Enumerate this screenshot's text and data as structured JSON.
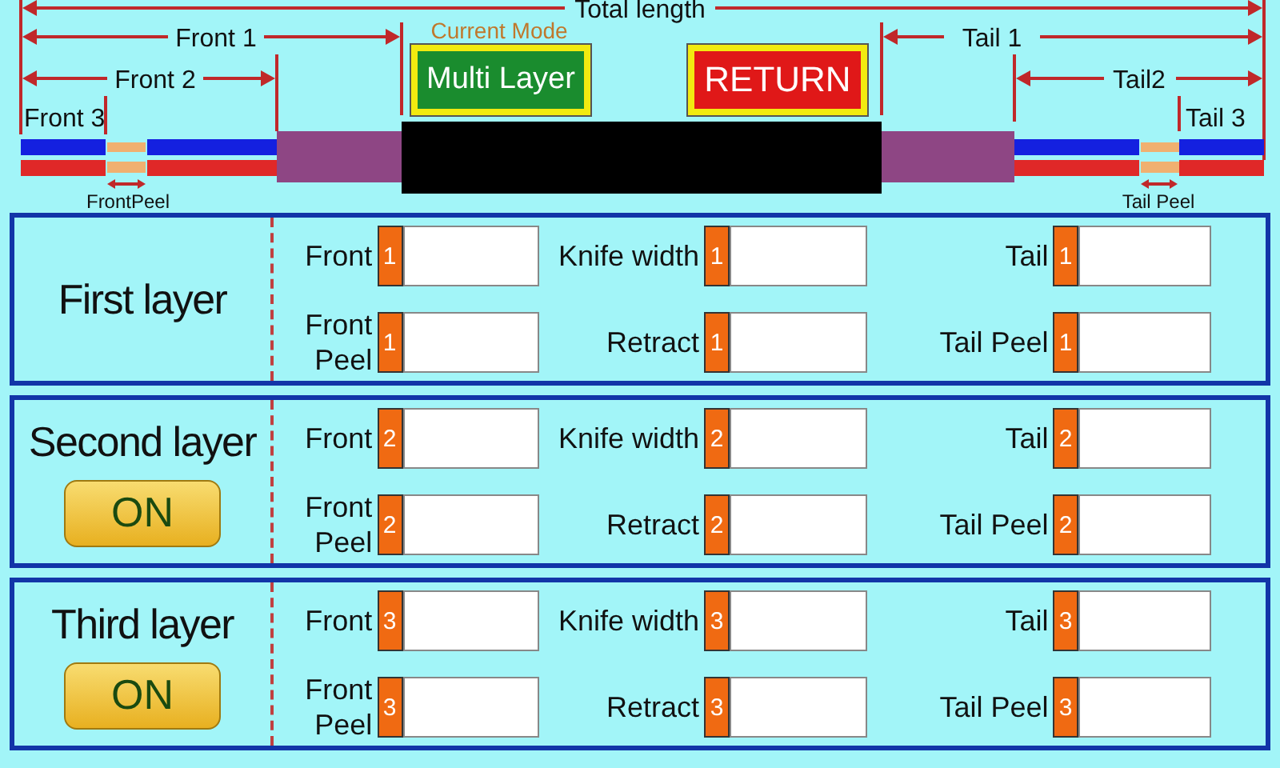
{
  "diagram": {
    "total_length": "Total length",
    "front_1": "Front 1",
    "front_2": "Front 2",
    "front_3": "Front 3",
    "front_peel": "FrontPeel",
    "tail_1": "Tail 1",
    "tail_2": "Tail2",
    "tail_3": "Tail 3",
    "tail_peel": "Tail Peel"
  },
  "mode": {
    "caption": "Current Mode",
    "button": "Multi Layer"
  },
  "return_button": "RETURN",
  "layers": [
    {
      "title": "First layer",
      "fields": [
        {
          "label": "Front",
          "tag": "1"
        },
        {
          "label": "Knife width",
          "tag": "1"
        },
        {
          "label": "Tail",
          "tag": "1"
        },
        {
          "label": "Front Peel",
          "tag": "1"
        },
        {
          "label": "Retract",
          "tag": "1"
        },
        {
          "label": "Tail Peel",
          "tag": "1"
        }
      ]
    },
    {
      "title": "Second layer",
      "toggle": "ON",
      "fields": [
        {
          "label": "Front",
          "tag": "2"
        },
        {
          "label": "Knife width",
          "tag": "2"
        },
        {
          "label": "Tail",
          "tag": "2"
        },
        {
          "label": "Front Peel",
          "tag": "2"
        },
        {
          "label": "Retract",
          "tag": "2"
        },
        {
          "label": "Tail Peel",
          "tag": "2"
        }
      ]
    },
    {
      "title": "Third layer",
      "toggle": "ON",
      "fields": [
        {
          "label": "Front",
          "tag": "3"
        },
        {
          "label": "Knife width",
          "tag": "3"
        },
        {
          "label": "Tail",
          "tag": "3"
        },
        {
          "label": "Front Peel",
          "tag": "3"
        },
        {
          "label": "Retract",
          "tag": "3"
        },
        {
          "label": "Tail Peel",
          "tag": "3"
        }
      ]
    }
  ]
}
